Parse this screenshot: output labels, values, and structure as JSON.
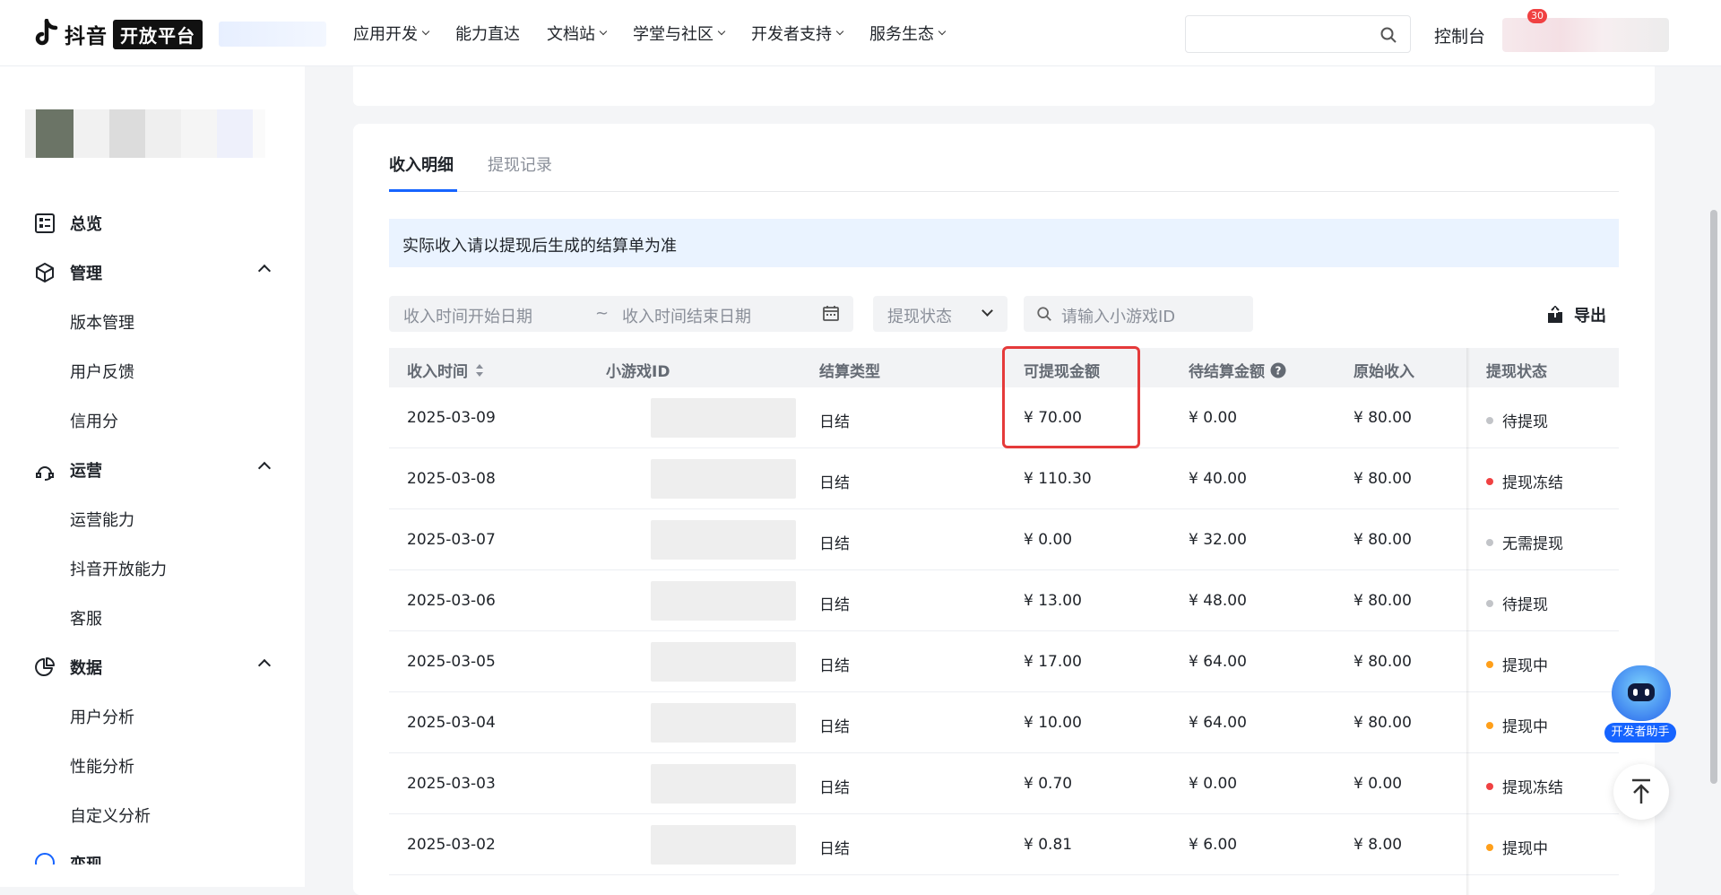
{
  "header": {
    "brand_text": "抖音",
    "brand_badge": "开放平台",
    "nav": [
      {
        "label": "应用开发",
        "has_dropdown": true
      },
      {
        "label": "能力直达",
        "has_dropdown": false
      },
      {
        "label": "文档站",
        "has_dropdown": true
      },
      {
        "label": "学堂与社区",
        "has_dropdown": true
      },
      {
        "label": "开发者支持",
        "has_dropdown": true
      },
      {
        "label": "服务生态",
        "has_dropdown": true
      }
    ],
    "search_placeholder": "",
    "console_label": "控制台",
    "notification_count": "30"
  },
  "sidebar": {
    "groups": [
      {
        "label": "总览",
        "icon": "dashboard-icon",
        "items": []
      },
      {
        "label": "管理",
        "icon": "cube-icon",
        "items": [
          "版本管理",
          "用户反馈",
          "信用分"
        ]
      },
      {
        "label": "运营",
        "icon": "operations-icon",
        "items": [
          "运营能力",
          "抖音开放能力",
          "客服"
        ]
      },
      {
        "label": "数据",
        "icon": "pie-chart-icon",
        "items": [
          "用户分析",
          "性能分析",
          "自定义分析"
        ]
      }
    ],
    "partial_item": "变现"
  },
  "tabs": [
    {
      "label": "收入明细",
      "active": true
    },
    {
      "label": "提现记录",
      "active": false
    }
  ],
  "notice": "实际收入请以提现后生成的结算单为准",
  "filters": {
    "start_date_placeholder": "收入时间开始日期",
    "range_separator": "~",
    "end_date_placeholder": "收入时间结束日期",
    "status_placeholder": "提现状态",
    "game_id_placeholder": "请输入小游戏ID",
    "export_label": "导出"
  },
  "table": {
    "columns": [
      "收入时间",
      "小游戏ID",
      "结算类型",
      "可提现金额",
      "待结算金额",
      "原始收入",
      "提现状态"
    ],
    "rows": [
      {
        "date": "2025-03-09",
        "type": "日结",
        "withdrawable": "¥ 70.00",
        "pending": "¥ 0.00",
        "original": "¥ 80.00",
        "status": "待提现",
        "status_color": "#c2c4c8"
      },
      {
        "date": "2025-03-08",
        "type": "日结",
        "withdrawable": "¥ 110.30",
        "pending": "¥ 40.00",
        "original": "¥ 80.00",
        "status": "提现冻结",
        "status_color": "#f04142"
      },
      {
        "date": "2025-03-07",
        "type": "日结",
        "withdrawable": "¥ 0.00",
        "pending": "¥ 32.00",
        "original": "¥ 80.00",
        "status": "无需提现",
        "status_color": "#c2c4c8"
      },
      {
        "date": "2025-03-06",
        "type": "日结",
        "withdrawable": "¥ 13.00",
        "pending": "¥ 48.00",
        "original": "¥ 80.00",
        "status": "待提现",
        "status_color": "#c2c4c8"
      },
      {
        "date": "2025-03-05",
        "type": "日结",
        "withdrawable": "¥ 17.00",
        "pending": "¥ 64.00",
        "original": "¥ 80.00",
        "status": "提现中",
        "status_color": "#ff9f1a"
      },
      {
        "date": "2025-03-04",
        "type": "日结",
        "withdrawable": "¥ 10.00",
        "pending": "¥ 64.00",
        "original": "¥ 80.00",
        "status": "提现中",
        "status_color": "#ff9f1a"
      },
      {
        "date": "2025-03-03",
        "type": "日结",
        "withdrawable": "¥ 0.70",
        "pending": "¥ 0.00",
        "original": "¥ 0.00",
        "status": "提现冻结",
        "status_color": "#f04142"
      },
      {
        "date": "2025-03-02",
        "type": "日结",
        "withdrawable": "¥ 0.81",
        "pending": "¥ 6.00",
        "original": "¥ 8.00",
        "status": "提现中",
        "status_color": "#ff9f1a"
      }
    ]
  },
  "assistant_label": "开发者助手",
  "colors": {
    "accent": "#1664ff",
    "highlight": "#e53a3a",
    "notice_bg": "#eaf3ff"
  }
}
